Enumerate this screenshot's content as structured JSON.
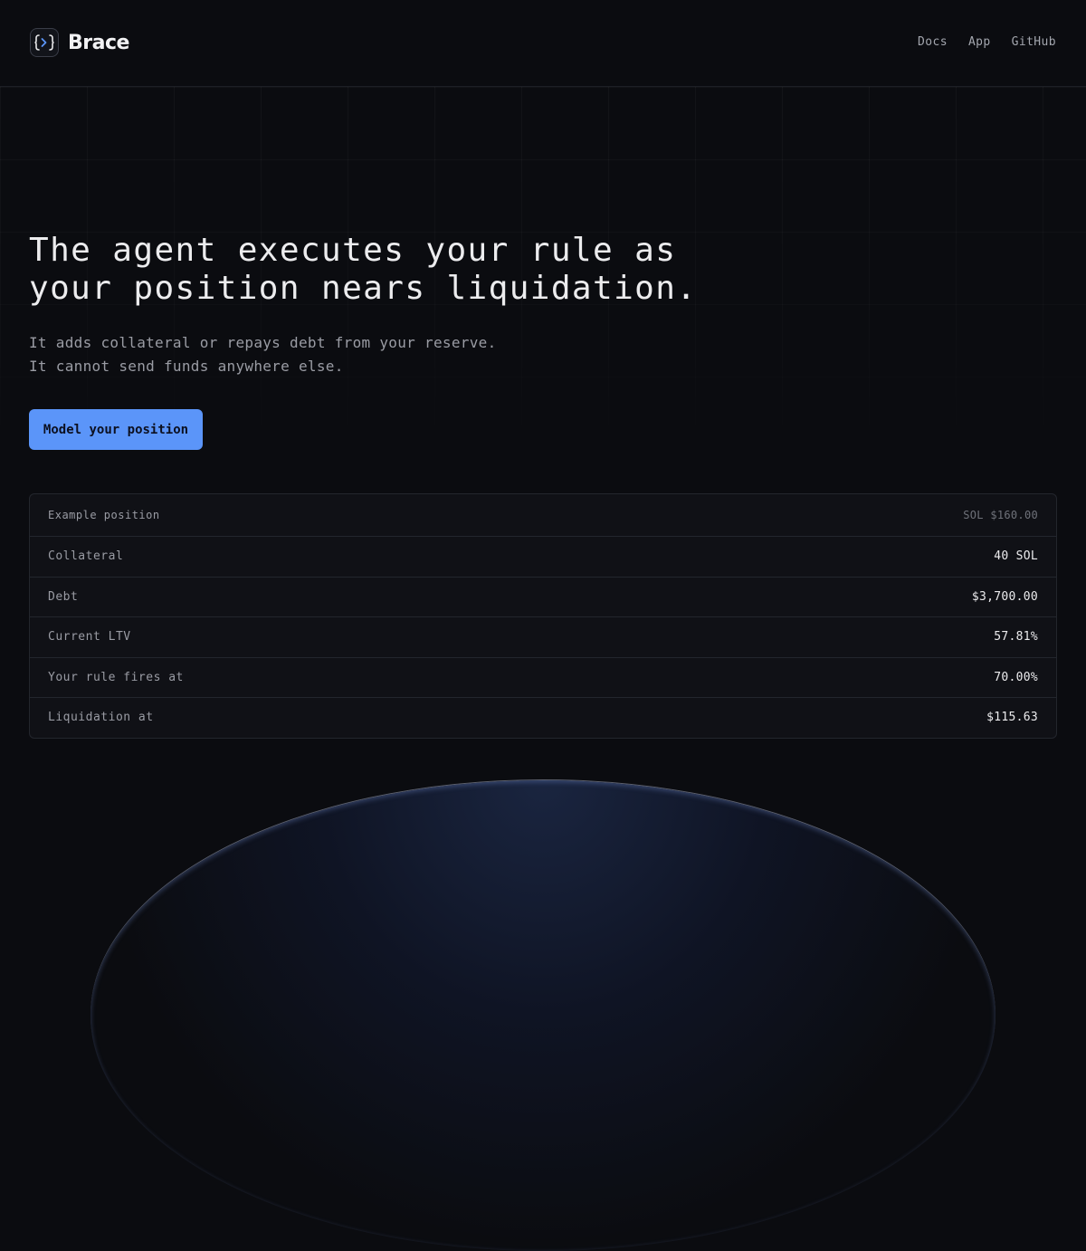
{
  "brand": {
    "name": "Brace",
    "accent": "#5b95f9"
  },
  "nav": {
    "items": [
      "Docs",
      "App",
      "GitHub"
    ]
  },
  "hero": {
    "headline_line1": "The agent executes your rule as",
    "headline_line2": "your position nears liquidation.",
    "sub_line1": "It adds collateral or repays debt from your reserve.",
    "sub_line2": "It cannot send funds anywhere else.",
    "cta_label": "Model your position"
  },
  "position": {
    "header_label": "Example position",
    "header_value": "SOL $160.00",
    "rows": [
      {
        "label": "Collateral",
        "value": "40 SOL"
      },
      {
        "label": "Debt",
        "value": "$3,700.00"
      },
      {
        "label": "Current LTV",
        "value": "57.81%"
      },
      {
        "label": "Your rule fires at",
        "value": "70.00%"
      },
      {
        "label": "Liquidation at",
        "value": "$115.63"
      }
    ]
  }
}
